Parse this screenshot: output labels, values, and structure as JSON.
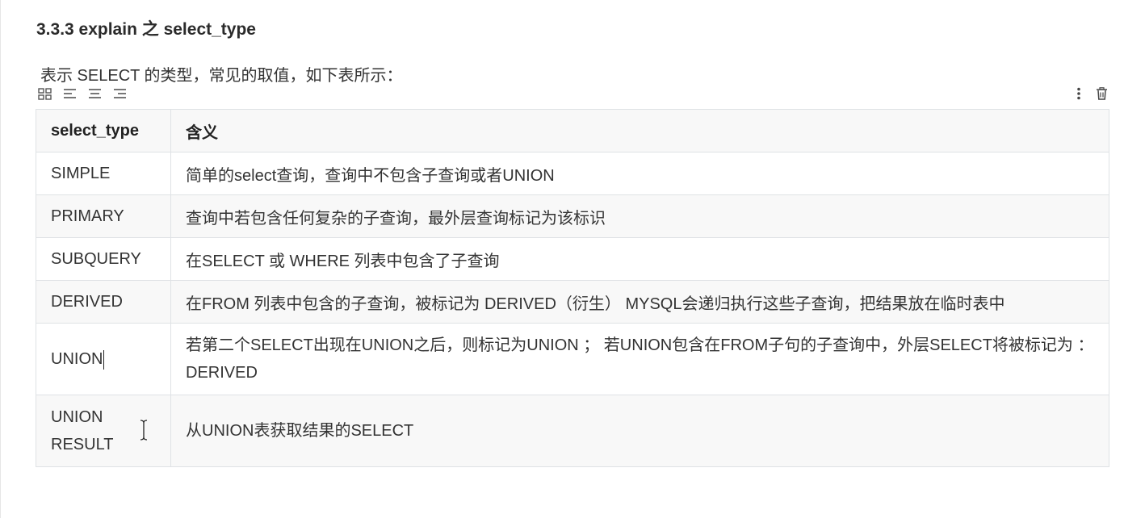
{
  "section": {
    "heading": "3.3.3 explain 之 select_type",
    "intro": "表示 SELECT 的类型，常见的取值，如下表所示："
  },
  "toolbar": {
    "left_icons": [
      "grid-icon",
      "align-left-icon",
      "align-center-icon",
      "align-right-icon"
    ],
    "right_icons": [
      "more-vertical-icon",
      "trash-icon"
    ]
  },
  "table": {
    "headers": [
      "select_type",
      "含义"
    ],
    "rows": [
      {
        "type": "SIMPLE",
        "meaning": "简单的select查询，查询中不包含子查询或者UNION"
      },
      {
        "type": "PRIMARY",
        "meaning": "查询中若包含任何复杂的子查询，最外层查询标记为该标识"
      },
      {
        "type": "SUBQUERY",
        "meaning": "在SELECT 或 WHERE 列表中包含了子查询"
      },
      {
        "type": "DERIVED",
        "meaning": "在FROM 列表中包含的子查询，被标记为 DERIVED（衍生） MYSQL会递归执行这些子查询，把结果放在临时表中"
      },
      {
        "type": "UNION",
        "meaning": "若第二个SELECT出现在UNION之后，则标记为UNION ； 若UNION包含在FROM子句的子查询中，外层SELECT将被标记为 ： DERIVED"
      },
      {
        "type": "UNION RESULT",
        "meaning": "从UNION表获取结果的SELECT"
      }
    ]
  },
  "colors": {
    "border": "#dfe2e5",
    "stripe": "#f8f8f8",
    "text": "#333333"
  }
}
